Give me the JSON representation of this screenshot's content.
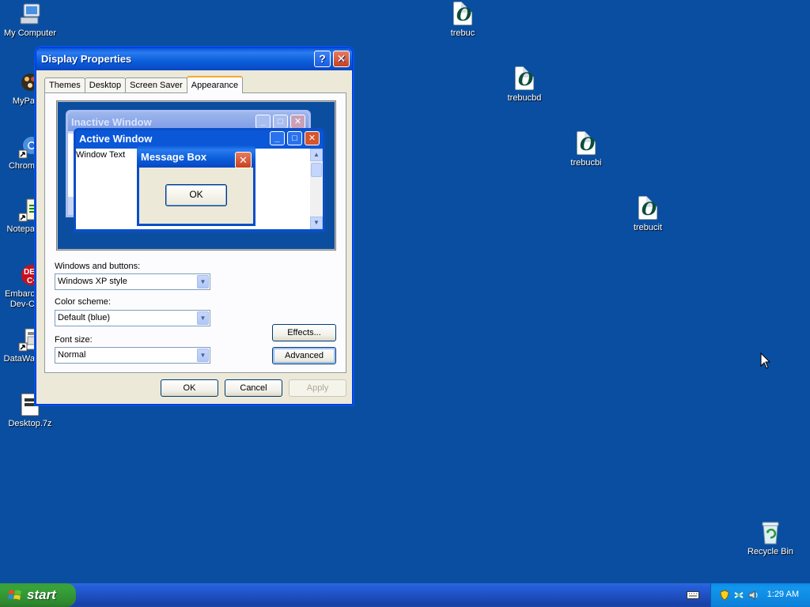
{
  "desktop": {
    "icons_left": [
      {
        "label": "My Computer",
        "icon": "my-computer-icon"
      },
      {
        "label": "MyPa",
        "icon": "mypaint-icon"
      },
      {
        "label": "Chrom",
        "icon": "chrome-shortcut-icon"
      },
      {
        "label": "Notepa",
        "icon": "notepad-shortcut-icon"
      },
      {
        "label": "Embarc Dev-C",
        "icon": "embarcadero-devcpp-icon"
      },
      {
        "label": "DataWa",
        "icon": "datawarrior-icon"
      },
      {
        "label": "Desktop.7z",
        "icon": "archive-file-icon"
      }
    ],
    "font_icons": [
      {
        "label": "trebuc",
        "icon": "font-file-icon"
      },
      {
        "label": "trebucbd",
        "icon": "font-file-icon"
      },
      {
        "label": "trebucbi",
        "icon": "font-file-icon"
      },
      {
        "label": "trebucit",
        "icon": "font-file-icon"
      }
    ],
    "recycle_bin": {
      "label": "Recycle Bin",
      "icon": "recycle-bin-icon"
    }
  },
  "dialog": {
    "title": "Display Properties",
    "help_glyph": "?",
    "close_glyph": "✕",
    "tabs": [
      {
        "label": "Themes"
      },
      {
        "label": "Desktop"
      },
      {
        "label": "Screen Saver"
      },
      {
        "label": "Appearance",
        "active": true
      }
    ],
    "preview": {
      "inactive_title": "Inactive Window",
      "active_title": "Active Window",
      "window_text": "Window Text",
      "message_box_title": "Message Box",
      "message_box_ok": "OK"
    },
    "windows_buttons_label": "Windows and buttons:",
    "windows_buttons_value": "Windows XP style",
    "color_scheme_label": "Color scheme:",
    "color_scheme_value": "Default (blue)",
    "font_size_label": "Font size:",
    "font_size_value": "Normal",
    "effects_button": "Effects...",
    "advanced_button": "Advanced",
    "ok_button": "OK",
    "cancel_button": "Cancel",
    "apply_button": "Apply"
  },
  "taskbar": {
    "start_label": "start",
    "clock": "1:29 AM"
  },
  "colors": {
    "desktop": "#0a4ea1",
    "title_bar": "#0a5ad8",
    "start_button": "#37a33a",
    "tray": "#1296ec"
  }
}
